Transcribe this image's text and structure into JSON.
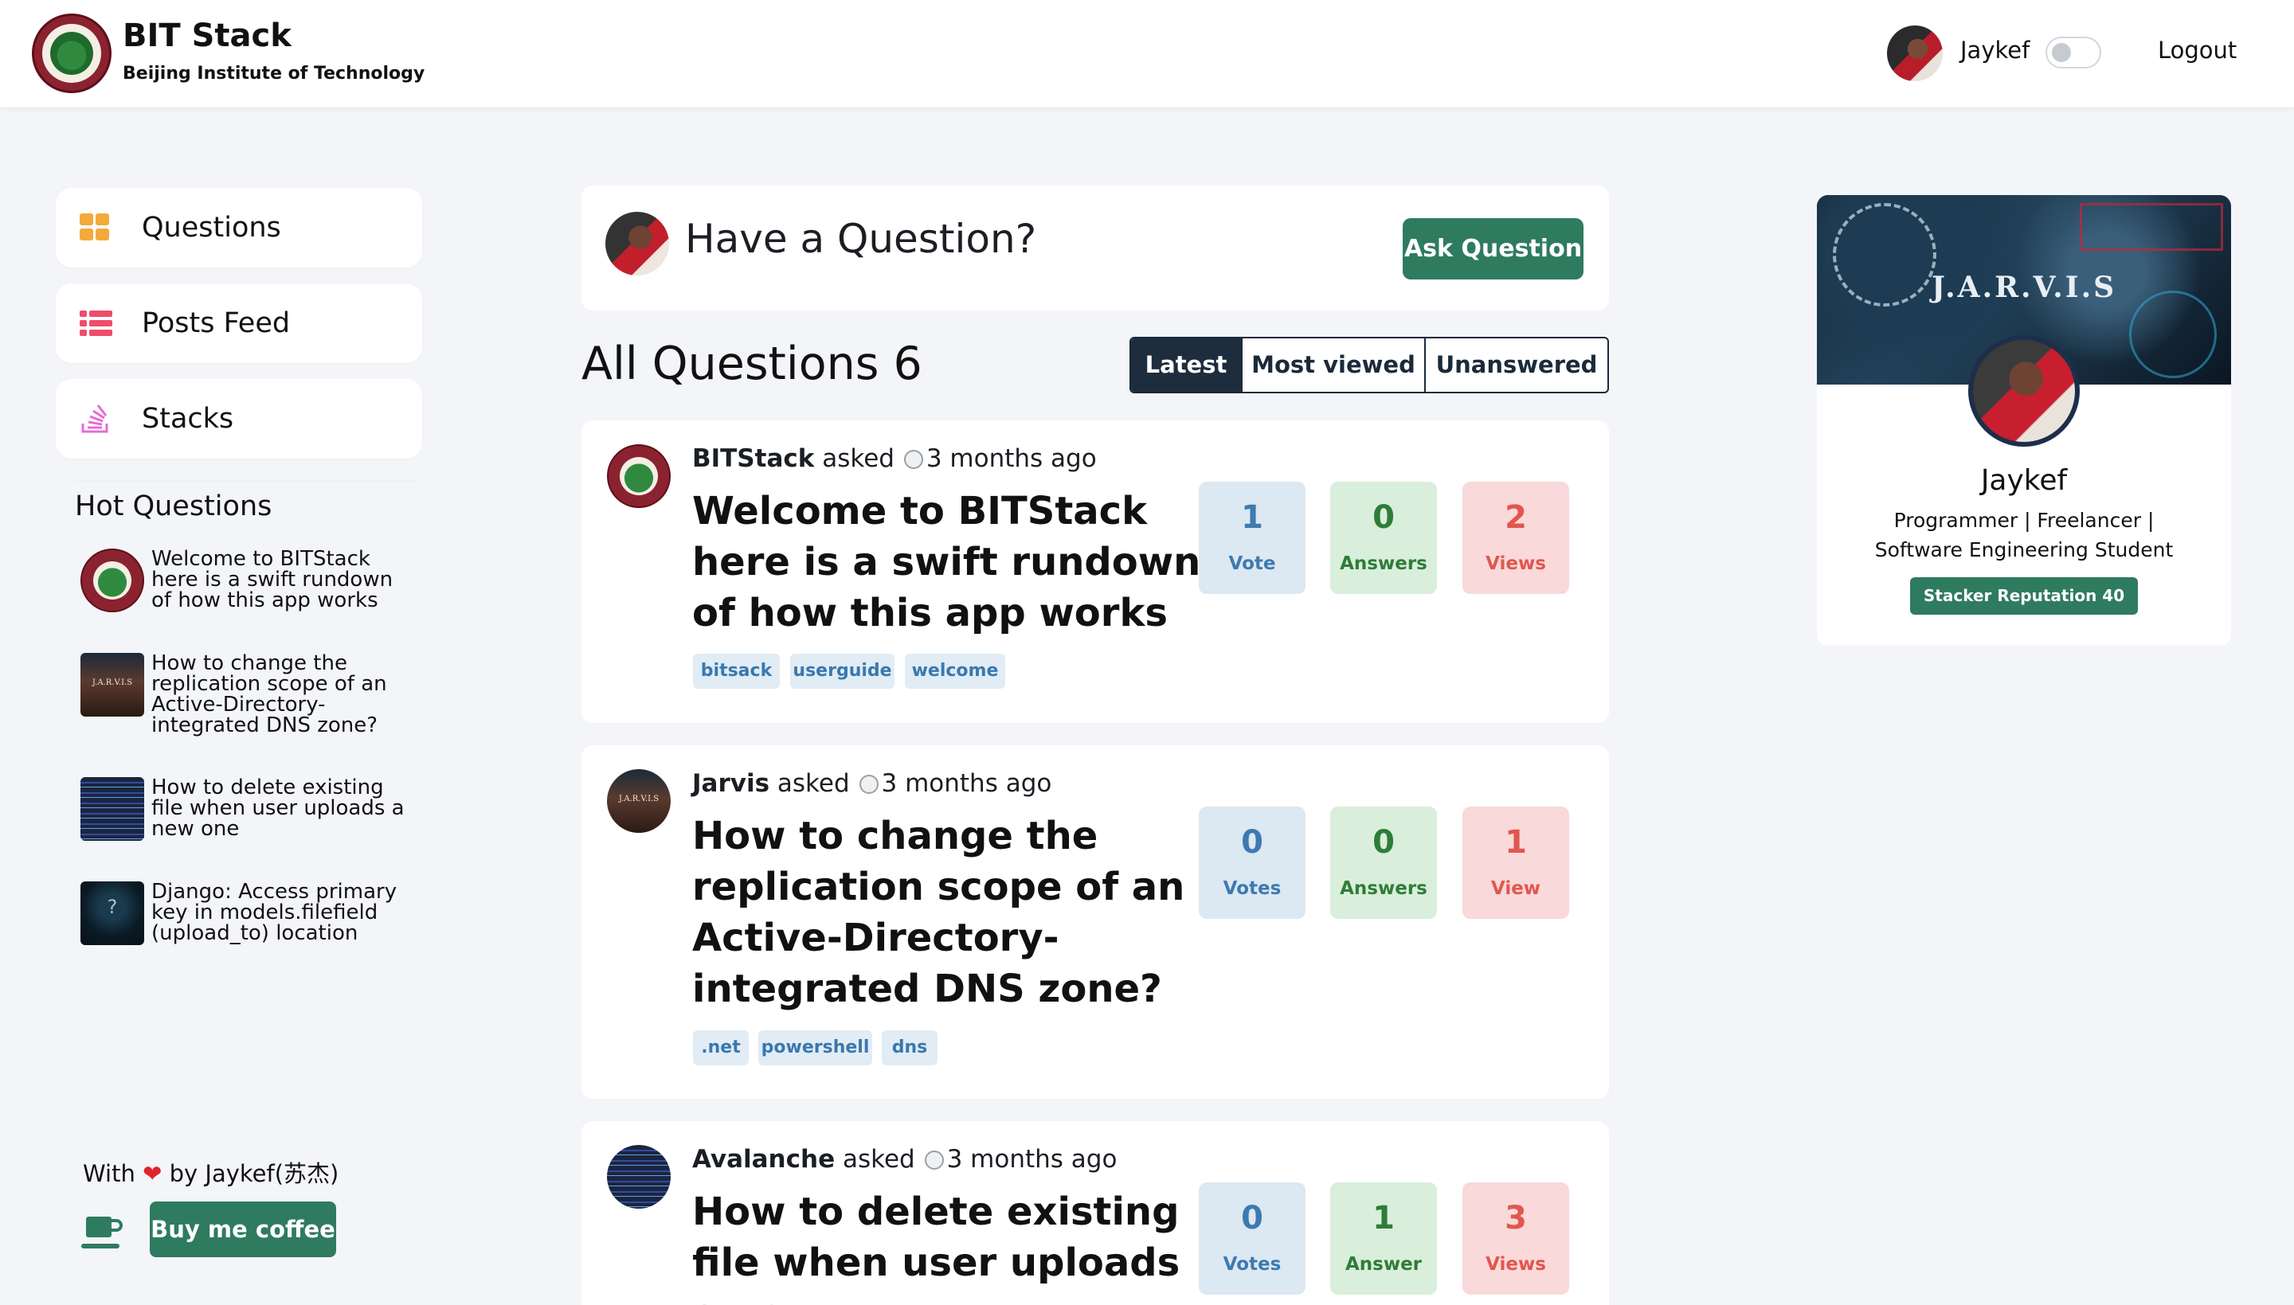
{
  "header": {
    "brand_title": "BIT Stack",
    "brand_subtitle": "Beijing Institute of Technology",
    "user_name": "Jaykef",
    "logout_label": "Logout"
  },
  "sidebar": {
    "nav": [
      {
        "label": "Questions",
        "icon": "grid-icon",
        "icon_color": "#f4a93a"
      },
      {
        "label": "Posts Feed",
        "icon": "list-icon",
        "icon_color": "#ee4d6a"
      },
      {
        "label": "Stacks",
        "icon": "stack-icon",
        "icon_color": "#e56bd6"
      }
    ],
    "hot_title": "Hot Questions",
    "hot_questions": [
      {
        "title": "Welcome to BITStack here is a swift rundown of how this app works",
        "thumb": "bit-logo"
      },
      {
        "title": "How to change the replication scope of an Active-Directory-integrated DNS zone?",
        "thumb": "jarvis"
      },
      {
        "title": "How to delete existing file when user uploads a new one",
        "thumb": "code"
      },
      {
        "title": "Django: Access primary key in models.filefield (upload_to) location",
        "thumb": "hood"
      }
    ],
    "footer_with": "With",
    "footer_by": "by Jaykef(苏杰)",
    "coffee_label": "Buy me coffee"
  },
  "main": {
    "ask_prompt": "Have a Question?",
    "ask_button": "Ask Question",
    "all_questions_label": "All Questions 6",
    "filters": [
      "Latest",
      "Most viewed",
      "Unanswered"
    ],
    "active_filter": "Latest",
    "questions": [
      {
        "author": "BITStack",
        "asked": "asked",
        "time": "3 months ago",
        "title": "Welcome to BITStack here is a swift rundown of how this app works",
        "votes": "1",
        "votes_label": "Vote",
        "answers": "0",
        "answers_label": "Answers",
        "views": "2",
        "views_label": "Views",
        "tags": [
          "bitsack",
          "userguide",
          "welcome"
        ]
      },
      {
        "author": "Jarvis",
        "asked": "asked",
        "time": "3 months ago",
        "title": "How to change the replication scope of an Active-Directory-integrated DNS zone?",
        "votes": "0",
        "votes_label": "Votes",
        "answers": "0",
        "answers_label": "Answers",
        "views": "1",
        "views_label": "View",
        "tags": [
          ".net",
          "powershell",
          "dns"
        ]
      },
      {
        "author": "Avalanche",
        "asked": "asked",
        "time": "3 months ago",
        "title": "How to delete existing file when user uploads a new",
        "votes": "0",
        "votes_label": "Votes",
        "answers": "1",
        "answers_label": "Answer",
        "views": "3",
        "views_label": "Views",
        "tags": []
      }
    ]
  },
  "profile": {
    "banner_text": "J.A.R.V.I.S",
    "name": "Jaykef",
    "bio": "Programmer | Freelancer | Software Engineering Student",
    "reputation": "Stacker Reputation 40"
  },
  "colors": {
    "accent_green": "#2f7b60",
    "filter_dark": "#1e2d3d",
    "vote_blue": "#3d7ab0",
    "answer_green": "#2e7d37",
    "view_red": "#e0574f"
  }
}
